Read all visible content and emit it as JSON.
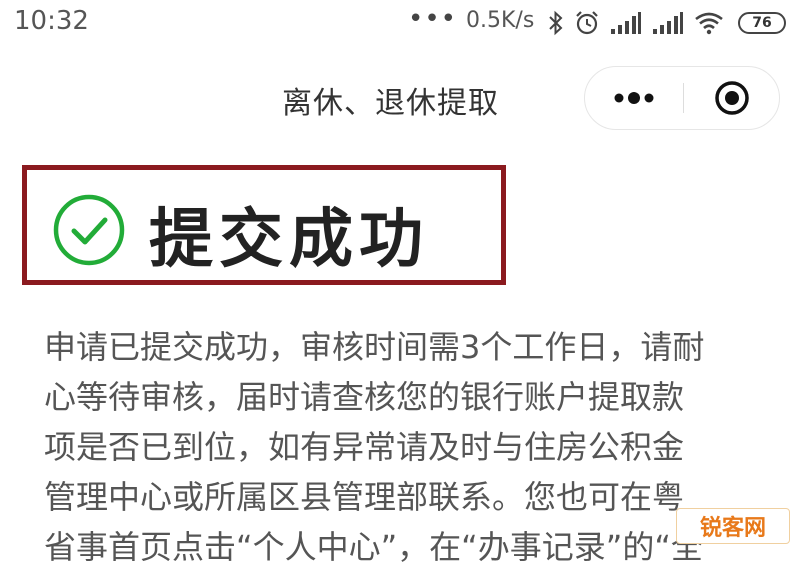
{
  "status_bar": {
    "time": "10:32",
    "dots": "•••",
    "network_speed": "0.5K/s",
    "icons": [
      "bluetooth-icon",
      "alarm-icon",
      "signal-icon",
      "signal-icon",
      "wifi-icon"
    ],
    "battery_level": "76"
  },
  "header": {
    "title": "离休、退休提取"
  },
  "success": {
    "title": "提交成功",
    "icon": "check-circle-icon",
    "icon_color": "#22ac38",
    "highlight_border_color": "#8b1a1f"
  },
  "description": {
    "lines": [
      "申请已提交成功，审核时间需3个工作日，请耐",
      "心等待审核，届时请查核您的银行账户提取款",
      "项是否已到位，如有异常请及时与住房公积金",
      "管理中心或所属区县管理部联系。您也可在粤",
      "省事首页点击“个人中心”，在“办事记录”的“全"
    ]
  },
  "watermark": {
    "text": "锐客网"
  }
}
